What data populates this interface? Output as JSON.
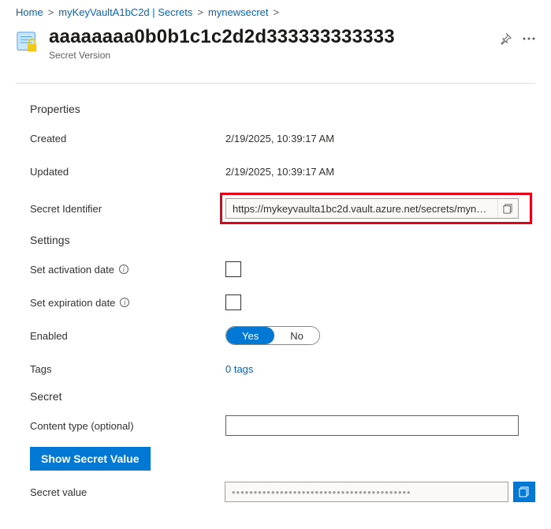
{
  "breadcrumbs": {
    "home": "Home",
    "vault": "myKeyVaultA1bC2d | Secrets",
    "secret": "mynewsecret"
  },
  "header": {
    "title": "aaaaaaaa0b0b1c1c2d2d333333333333",
    "subtitle": "Secret Version"
  },
  "sections": {
    "properties": "Properties",
    "settings": "Settings",
    "secret": "Secret"
  },
  "properties": {
    "created_label": "Created",
    "created_value": "2/19/2025, 10:39:17 AM",
    "updated_label": "Updated",
    "updated_value": "2/19/2025, 10:39:17 AM",
    "secret_id_label": "Secret Identifier",
    "secret_id_value": "https://mykeyvaulta1bc2d.vault.azure.net/secrets/mynewsec..."
  },
  "settings": {
    "activation_label": "Set activation date",
    "expiration_label": "Set expiration date",
    "enabled_label": "Enabled",
    "enabled_yes": "Yes",
    "enabled_no": "No",
    "tags_label": "Tags",
    "tags_value": "0 tags"
  },
  "secret": {
    "content_type_label": "Content type (optional)",
    "content_type_value": "",
    "show_button": "Show Secret Value",
    "value_label": "Secret value",
    "value_masked": "•••••••••••••••••••••••••••••••••••••••••"
  }
}
